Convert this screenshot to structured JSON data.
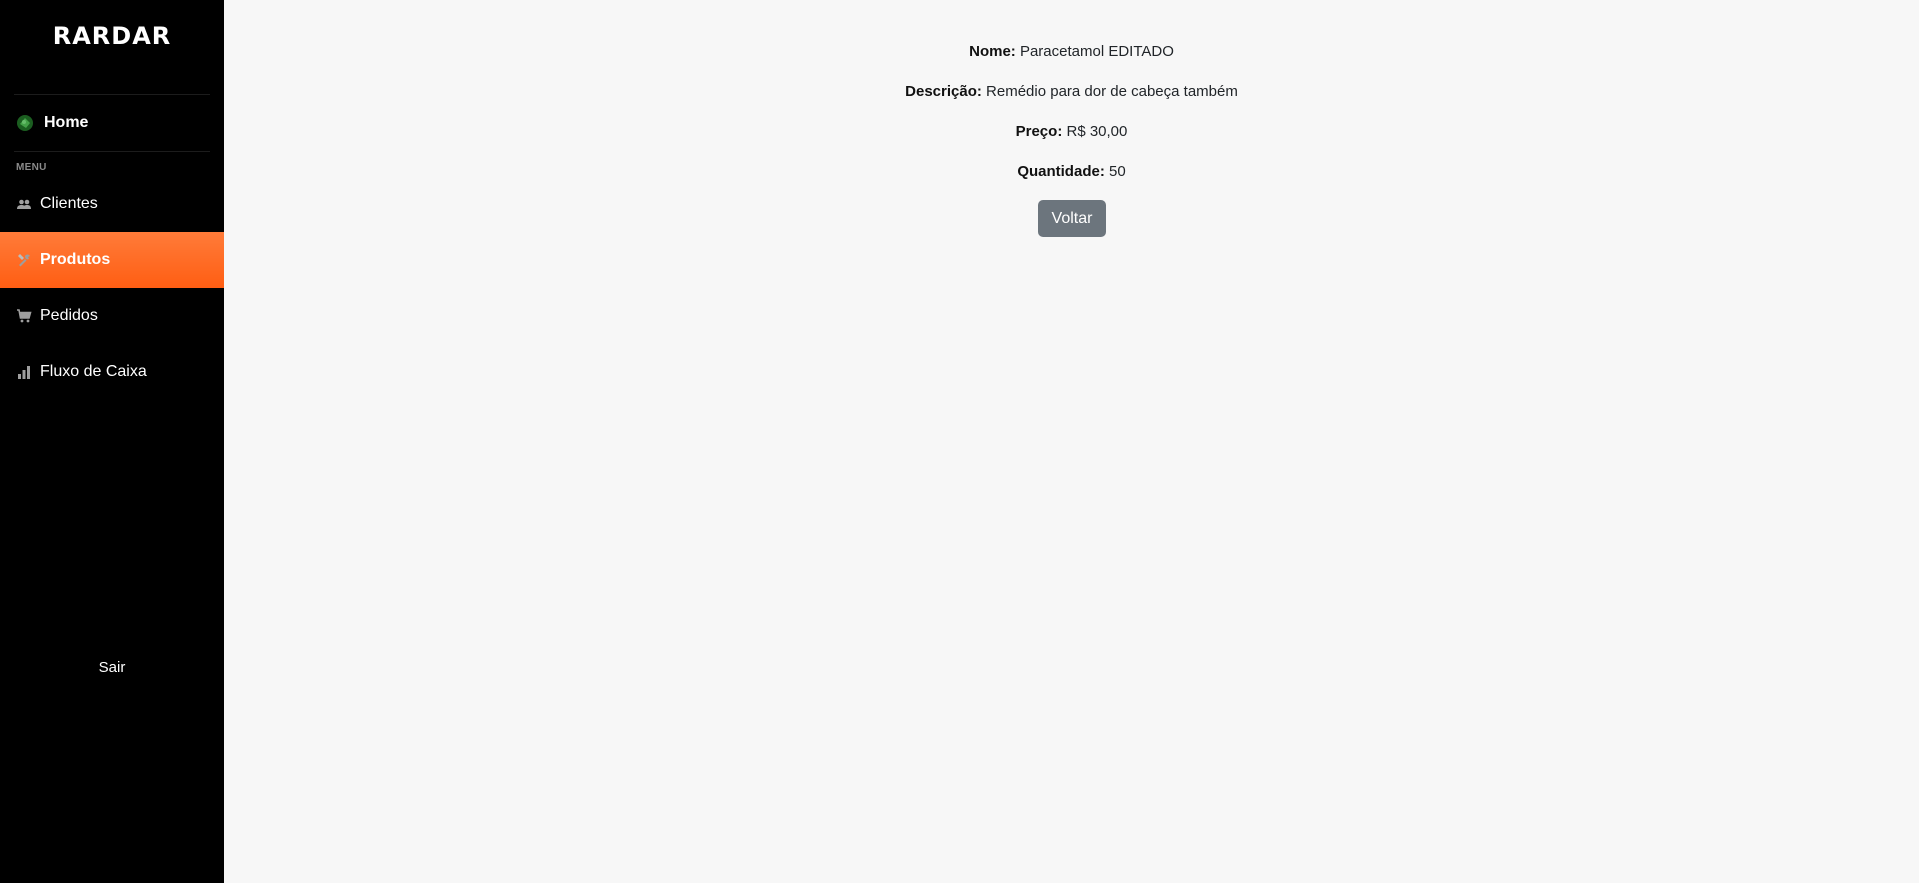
{
  "sidebar": {
    "logo": "RARDAR",
    "home_label": "Home",
    "menu_heading": "MENU",
    "items": [
      {
        "label": "Clientes",
        "icon": "users-icon"
      },
      {
        "label": "Produtos",
        "icon": "tools-icon",
        "active": true
      },
      {
        "label": "Pedidos",
        "icon": "cart-icon"
      },
      {
        "label": "Fluxo de Caixa",
        "icon": "bar-chart-icon"
      }
    ],
    "logout_label": "Sair"
  },
  "product": {
    "name_label": "Nome:",
    "name_value": "Paracetamol EDITADO",
    "description_label": "Descrição:",
    "description_value": "Remédio para dor de cabeça também",
    "price_label": "Preço:",
    "price_value": "R$ 30,00",
    "quantity_label": "Quantidade:",
    "quantity_value": "50",
    "back_button": "Voltar"
  },
  "colors": {
    "sidebar_bg": "#000000",
    "active_item": "#ff6a24",
    "page_bg": "#f7f7f7",
    "back_button": "#6c757d"
  }
}
